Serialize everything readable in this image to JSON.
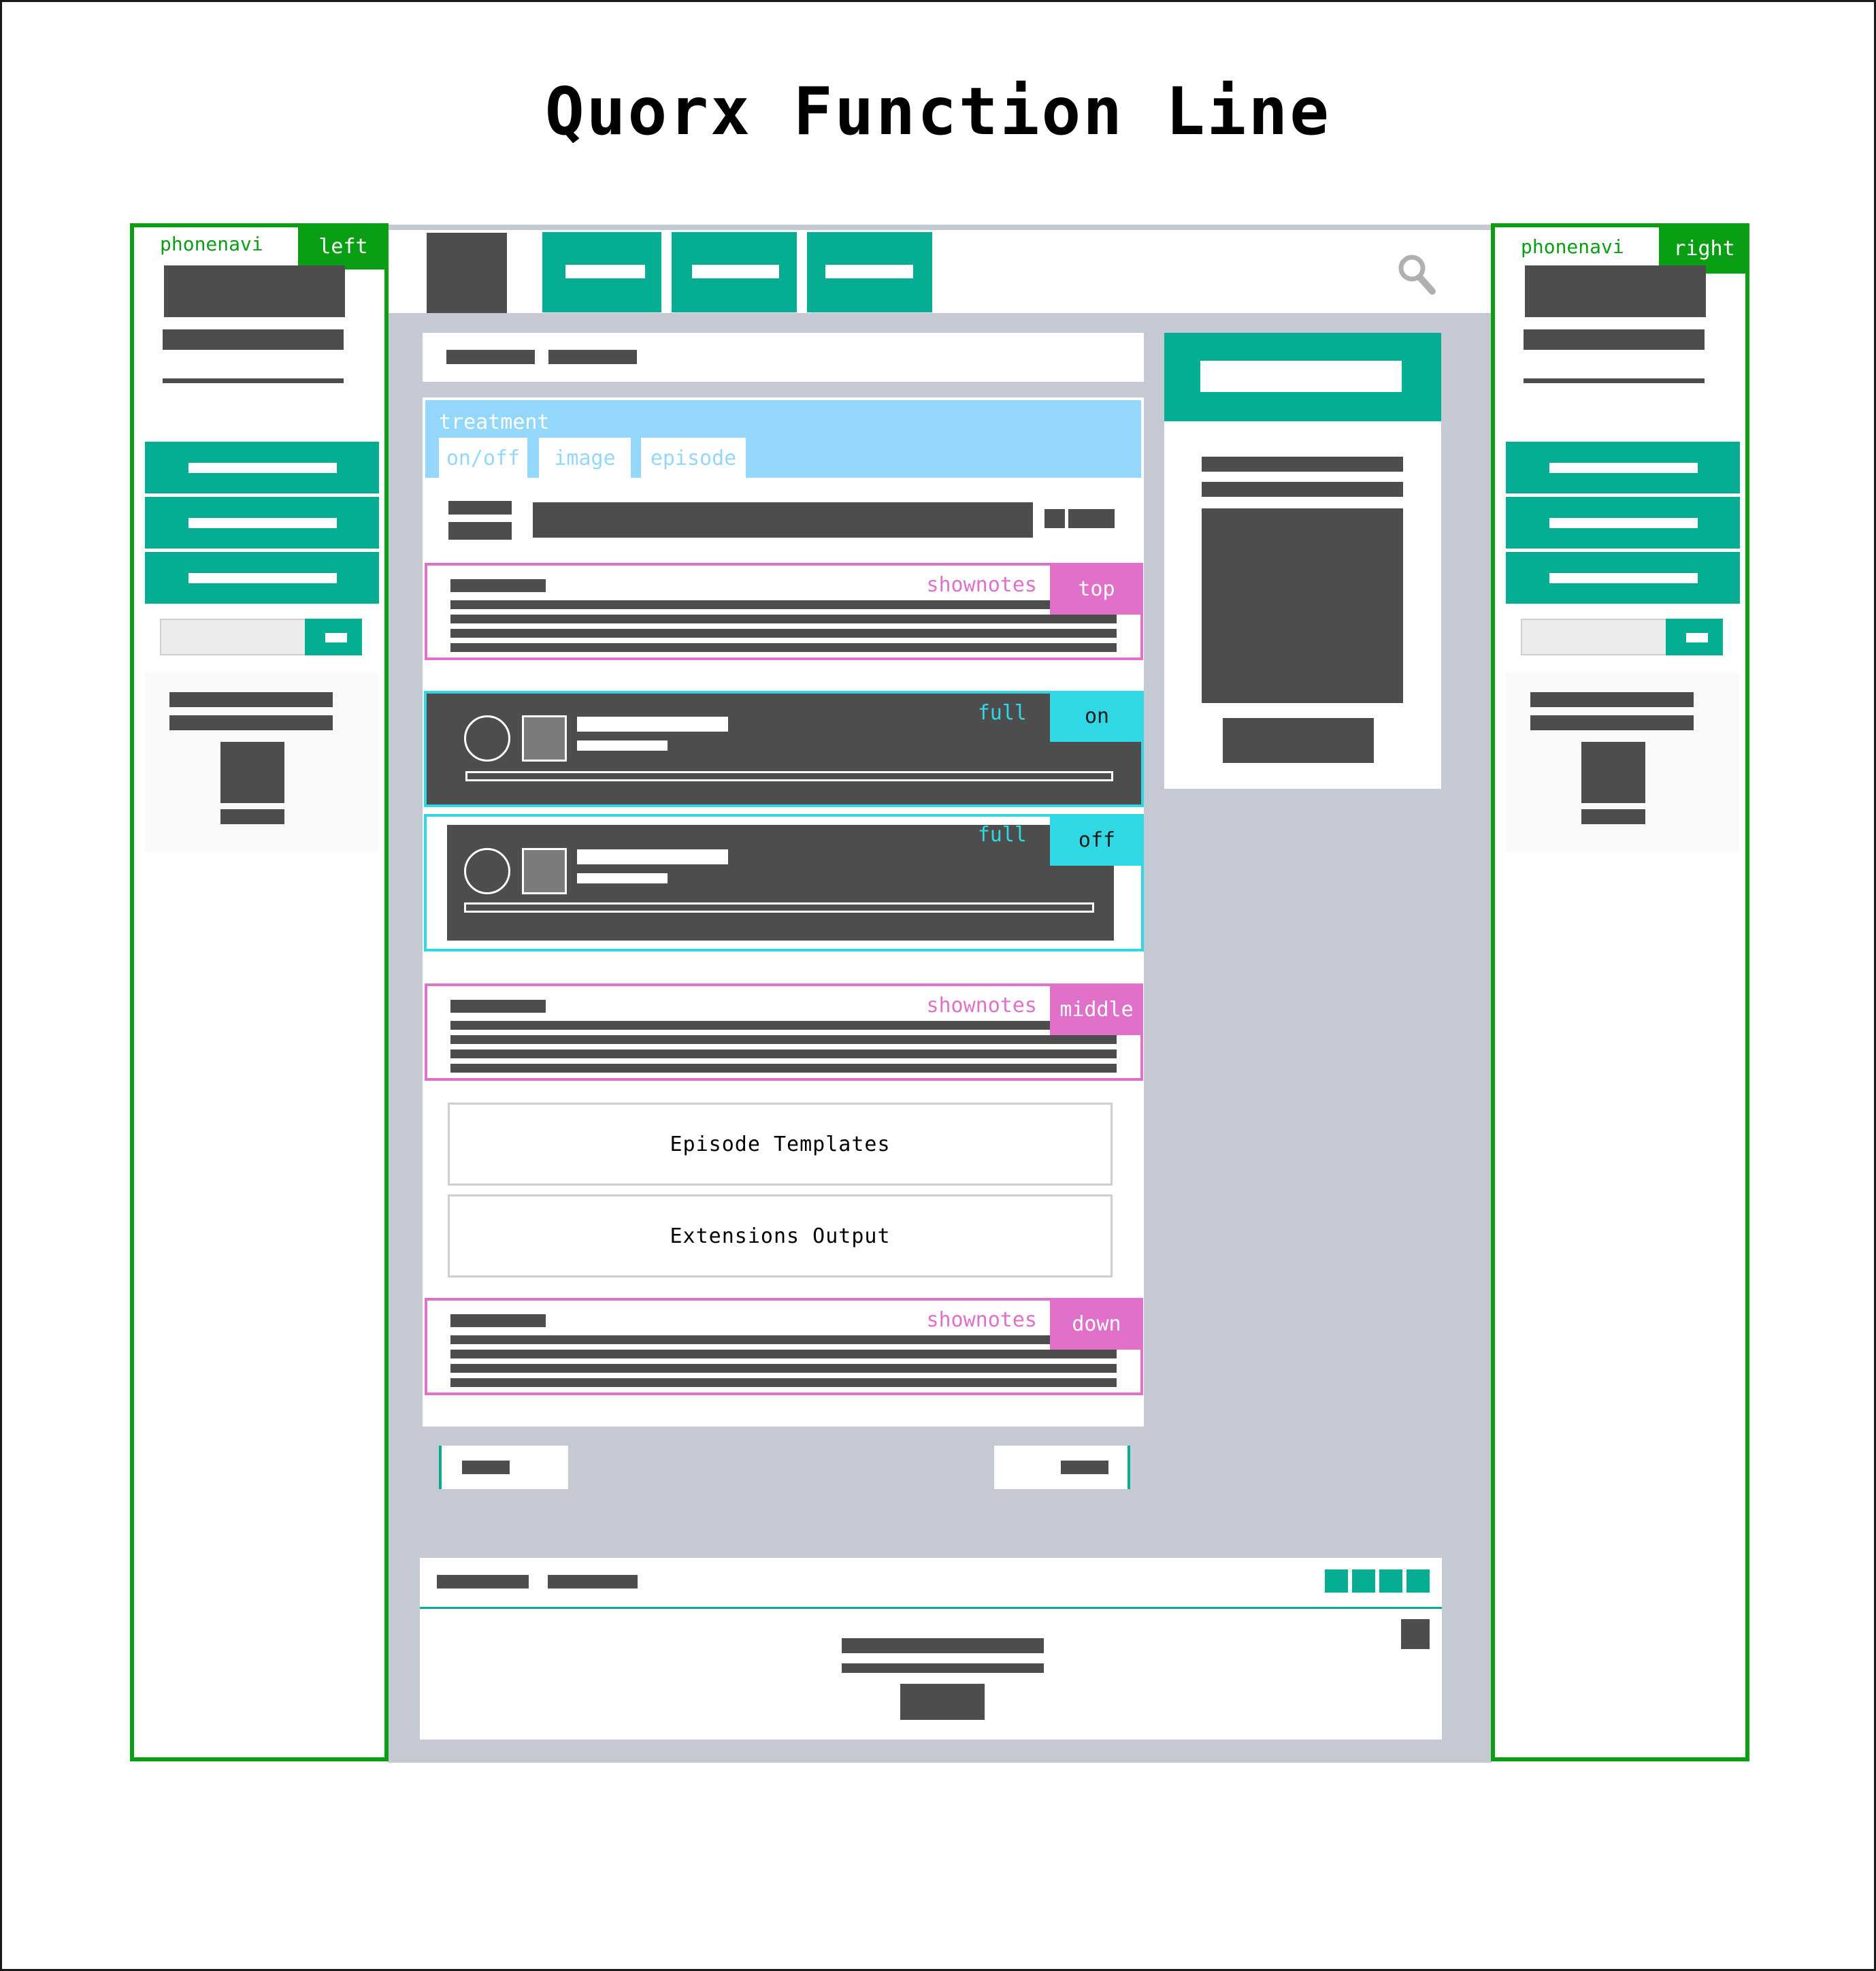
{
  "title": "Quorx Function Line",
  "colors": {
    "teal": "#05ad92",
    "green": "#0a9e14",
    "pink": "#e170c8",
    "cyan": "#2fd8e4",
    "light_blue": "#93d8fa",
    "dark": "#4d4d4d",
    "gray_bg": "#c5c9d4"
  },
  "left_panel": {
    "tag": "phonenavi",
    "side": "left"
  },
  "right_panel": {
    "tag": "phonenavi",
    "side": "right"
  },
  "header": {
    "search_icon": "search-icon"
  },
  "treatment": {
    "label": "treatment",
    "tabs": [
      "on/off",
      "image",
      "episode"
    ]
  },
  "shownotes": {
    "label": "shownotes",
    "top": "top",
    "middle": "middle",
    "down": "down"
  },
  "player": {
    "label": "full",
    "on": "on",
    "off": "off"
  },
  "boxes": {
    "episode_templates": "Episode Templates",
    "extensions_output": "Extensions Output"
  }
}
